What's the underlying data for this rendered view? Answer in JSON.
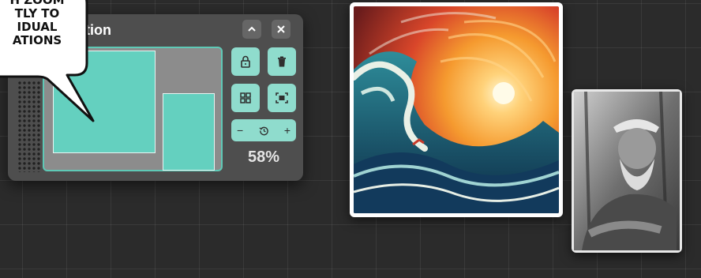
{
  "panel": {
    "title": "ation",
    "zoom": "58%",
    "buttons": {
      "collapse": "chevron-up-icon",
      "close": "close-icon",
      "lock": "lock-icon",
      "delete": "trash-icon",
      "grid": "grid-icon",
      "fit": "fit-to-screen-icon",
      "zoom_out": "minus-icon",
      "reset": "history-icon",
      "zoom_in": "plus-icon"
    },
    "zoom_minus": "−",
    "zoom_plus": "+"
  },
  "callout": {
    "lines": [
      "H ZOOM",
      "TLY TO",
      "IDUAL",
      "ATIONS"
    ]
  },
  "colors": {
    "accent": "#8fdccd",
    "panel_bg": "#4e4e4e",
    "canvas_bg": "#2b2b2b"
  }
}
